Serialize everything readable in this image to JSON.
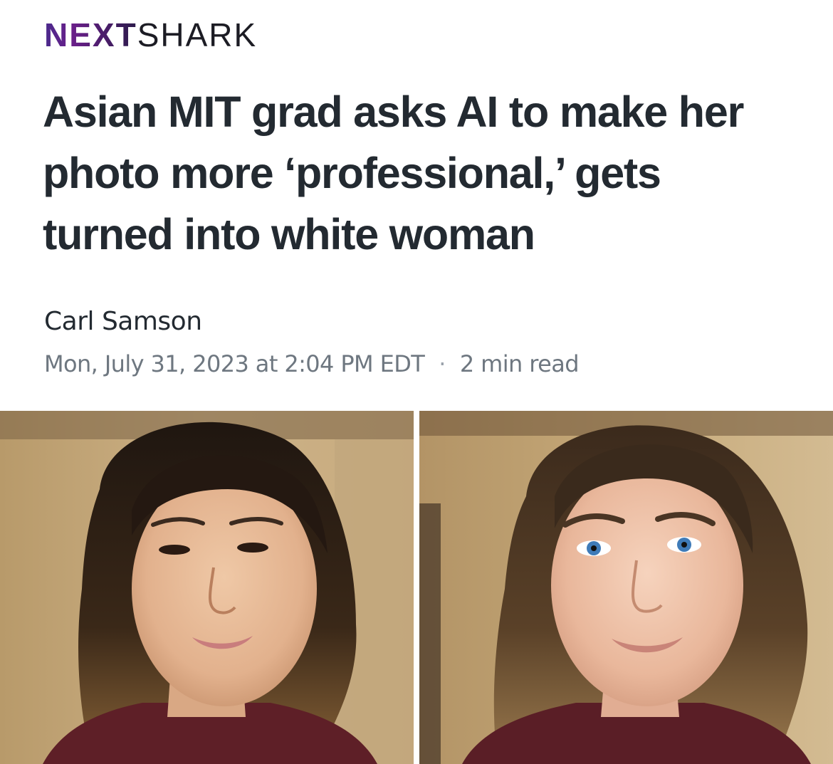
{
  "brand": {
    "logo_bold": "NEXT",
    "logo_regular": "SHARK"
  },
  "article": {
    "headline": "Asian MIT grad asks AI to make her photo more ‘professional,’ gets turned into white woman",
    "author": "Carl Samson",
    "date": "Mon, July 31, 2023 at 2:04 PM EDT",
    "separator": "·",
    "read_time": "2 min read"
  },
  "images": [
    {
      "icon": "portrait-original-photo"
    },
    {
      "icon": "portrait-ai-edited-photo"
    }
  ],
  "colors": {
    "headline": "#232a31",
    "meta": "#6e7780",
    "logo_accent": "#5b2a8c"
  }
}
